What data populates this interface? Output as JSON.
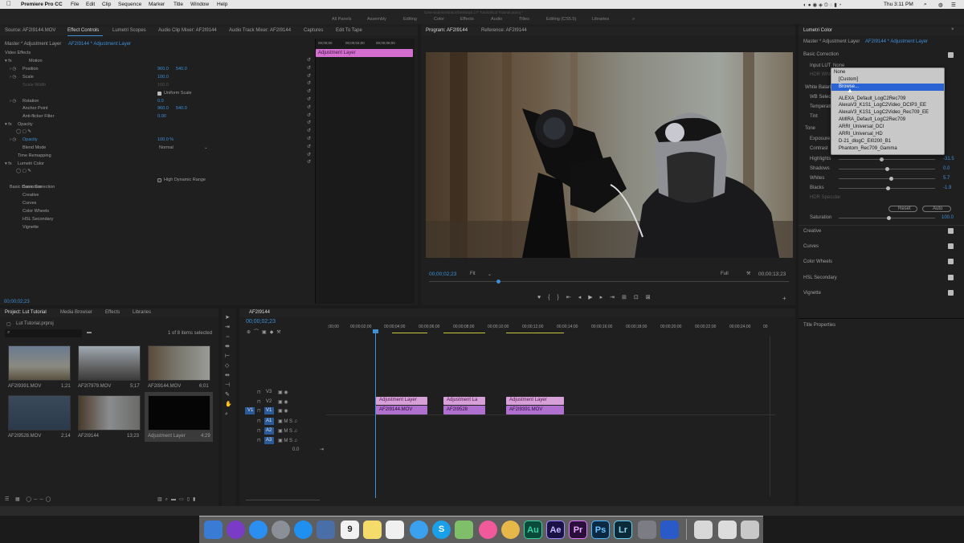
{
  "menubar": {
    "apple": "",
    "app": "Premiere Pro CC",
    "items": [
      "File",
      "Edit",
      "Clip",
      "Sequence",
      "Marker",
      "Title",
      "Window",
      "Help"
    ],
    "clock": "Thu 3:11 PM",
    "path": "/Users/administrator/Desktop/LUT Tutorial/Lut Tutorial.prproj *"
  },
  "workspaces": [
    "All Panels",
    "Assembly",
    "Editing",
    "Color",
    "Effects",
    "Audio",
    "Titles",
    "Editing (CS5.5)",
    "Libraries"
  ],
  "source_tabs": [
    "Source: AF2I9144.MOV",
    "Effect Controls",
    "Lumetri Scopes",
    "Audio Clip Mixer: AF2I9144",
    "Audio Track Mixer: AF2I9144",
    "Captures",
    "Edit To Tape"
  ],
  "effect_controls": {
    "breadcrumb_master": "Master * Adjustment Layer",
    "breadcrumb_clip": "AF2I9144 * Adjustment Layer",
    "video_effects": "Video Effects",
    "motion": "Motion",
    "position": "Position",
    "position_x": "960.0",
    "position_y": "540.0",
    "scale": "Scale",
    "scale_val": "100.0",
    "scale_width": "Scale Width",
    "scale_width_val": "100.0",
    "uniform_scale": "Uniform Scale",
    "rotation": "Rotation",
    "rotation_val": "0.0",
    "anchor": "Anchor Point",
    "anchor_x": "960.0",
    "anchor_y": "540.0",
    "antiflicker": "Anti-flicker Filter",
    "antiflicker_val": "0.00",
    "opacity": "Opacity",
    "opacity_sub": "Opacity",
    "opacity_val": "100.0 %",
    "blend": "Blend Mode",
    "blend_val": "Normal",
    "time_remap": "Time Remapping",
    "lumetri": "Lumetri Color",
    "hdr": "High Dynamic Range",
    "subs": [
      "Basic Correction",
      "Creative",
      "Curves",
      "Color Wheels",
      "HSL Secondary",
      "Vignette"
    ],
    "timecode": "00;00;02;23",
    "clip_label": "Adjustment Layer",
    "ruler": [
      "00;00;00",
      "00;00;04;00",
      "00;00;08;00"
    ]
  },
  "program": {
    "tab": "Program: AF2I9144",
    "ref_tab": "Reference: AF2I9144",
    "timecode": "00;00;02;23",
    "fit": "Fit",
    "full": "Full",
    "duration": "00;00;13;23"
  },
  "project": {
    "tabs": [
      "Project: Lut Tutorial",
      "Media Browser",
      "Effects",
      "Libraries"
    ],
    "file": "Lut Tutorial.prproj",
    "count": "1 of 8 items selected",
    "items": [
      {
        "name": "AF2I9391.MOV",
        "dur": "1;21"
      },
      {
        "name": "AF2I7979.MOV",
        "dur": "5;17"
      },
      {
        "name": "AF2I9144.MOV",
        "dur": "6;01"
      },
      {
        "name": "AF2I9528.MOV",
        "dur": "2;14"
      },
      {
        "name": "AF2I9144",
        "dur": "13;23"
      },
      {
        "name": "Adjustment Layer",
        "dur": "4;29"
      }
    ]
  },
  "timeline": {
    "tab": "AF2I9144",
    "timecode": "00;00;02;23",
    "ruler": [
      ";00;00",
      "00;00;02;00",
      "00;00;04;00",
      "00;00;06;00",
      "00;00;08;00",
      "00;00;10;00",
      "00;00;12;00",
      "00;00;14;00",
      "00;00;16;00",
      "00;00;18;00",
      "00;00;20;00",
      "00;00;22;00",
      "00;00;24;00",
      "00"
    ],
    "tracks": [
      "V3",
      "V2",
      "V1",
      "A1",
      "A2",
      "A3"
    ],
    "master": "0.0",
    "v2_clips": [
      "Adjustment Layer",
      "Adjustment La",
      "Adjustment Layer"
    ],
    "v1_clips": [
      "AF2I9144.MOV",
      "AF2I9528",
      "AF2I9391.MOV"
    ]
  },
  "lumetri": {
    "title": "Lumetri Color",
    "breadcrumb_master": "Master * Adjustment Layer",
    "breadcrumb_clip": "AF2I9144 * Adjustment Layer",
    "basic": "Basic Correction",
    "input_lut": "Input LUT",
    "lut_value": "None",
    "hdr_white": "HDR White",
    "white_balance": "White Balance",
    "wb_selector": "WB Selector",
    "temperature": "Temperature",
    "tint": "Tint",
    "tone": "Tone",
    "exposure": "Exposure",
    "contrast": "Contrast",
    "highlights": "Highlights",
    "highlights_val": "-31.5",
    "shadows": "Shadows",
    "shadows_val": "0.0",
    "whites": "Whites",
    "whites_val": "5.7",
    "blacks": "Blacks",
    "blacks_val": "-1.9",
    "hdr_specular": "HDR Specular",
    "reset": "Reset",
    "auto": "Auto",
    "saturation": "Saturation",
    "saturation_val": "100.0",
    "sections": [
      "Creative",
      "Curves",
      "Color Wheels",
      "HSL Secondary",
      "Vignette"
    ],
    "title_properties": "Title Properties",
    "dropdown": [
      "None",
      "[Custom]",
      "Browse...",
      "ALEXA_Default_LogC2Rec709",
      "AlexaV3_K1S1_LogC2Video_DCIP3_EE",
      "AlexaV3_K1S1_LogC2Video_Rec709_EE",
      "AMIRA_Default_LogC2Rec709",
      "ARRI_Universal_DCI",
      "ARRI_Universal_HD",
      "D-21_dlogC_EI0200_B1",
      "Phantom_Rec709_Gamma"
    ]
  },
  "dock": [
    {
      "icon": "finder-icon",
      "color": "#3a7bd5",
      "label": ""
    },
    {
      "icon": "siri-icon",
      "color": "#7a3cc6",
      "label": ""
    },
    {
      "icon": "appstore-icon",
      "color": "#2a8ff0",
      "label": ""
    },
    {
      "icon": "launchpad-icon",
      "color": "#8a8f98",
      "label": ""
    },
    {
      "icon": "safari-icon",
      "color": "#1f8ff0",
      "label": ""
    },
    {
      "icon": "preview-icon",
      "color": "#4a6ea8",
      "label": ""
    },
    {
      "icon": "calendar-icon",
      "color": "#f2f2f2",
      "label": "9"
    },
    {
      "icon": "notes-icon",
      "color": "#f5dc6a",
      "label": ""
    },
    {
      "icon": "reminders-icon",
      "color": "#f0f0f0",
      "label": ""
    },
    {
      "icon": "messages-icon",
      "color": "#3aa0f0",
      "label": ""
    },
    {
      "icon": "skype-icon",
      "color": "#1aa0e8",
      "label": "S"
    },
    {
      "icon": "maps-icon",
      "color": "#7fbf6a",
      "label": ""
    },
    {
      "icon": "itunes-icon",
      "color": "#f05a9a",
      "label": ""
    },
    {
      "icon": "photos-icon",
      "color": "#e6b84a",
      "label": ""
    },
    {
      "icon": "audition-icon",
      "color": "#0a4a3a",
      "label": "Au"
    },
    {
      "icon": "aftereffects-icon",
      "color": "#1a1244",
      "label": "Ae"
    },
    {
      "icon": "premiere-icon",
      "color": "#2a0f3a",
      "label": "Pr"
    },
    {
      "icon": "photoshop-icon",
      "color": "#0a2a44",
      "label": "Ps"
    },
    {
      "icon": "lightroom-icon",
      "color": "#0a2a3a",
      "label": "Lr"
    },
    {
      "icon": "settings-icon",
      "color": "#7c7c84",
      "label": ""
    },
    {
      "icon": "screenflow-icon",
      "color": "#2a5ac8",
      "label": ""
    },
    {
      "icon": "document-icon",
      "color": "#d8d8d8",
      "label": ""
    },
    {
      "icon": "mail-icon",
      "color": "#dcdcdc",
      "label": ""
    },
    {
      "icon": "trash-icon",
      "color": "#c8c8c8",
      "label": ""
    }
  ]
}
